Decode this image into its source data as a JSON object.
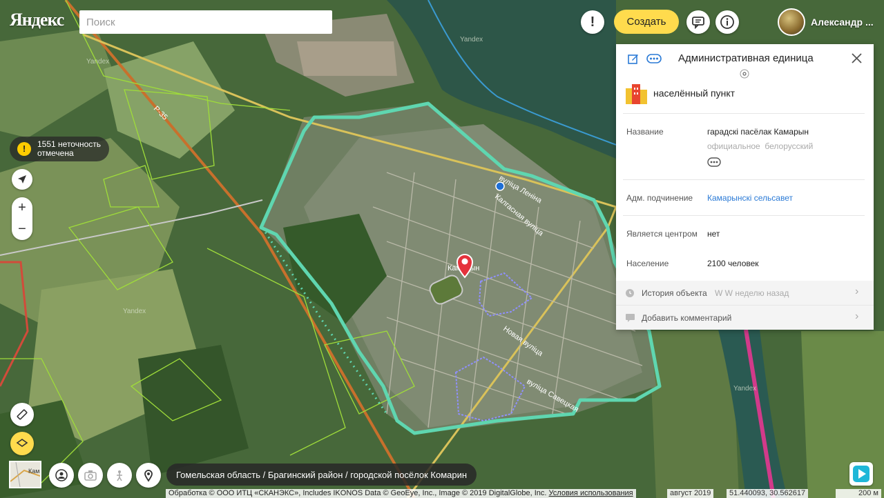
{
  "app": {
    "logo": "Яндекс"
  },
  "search": {
    "placeholder": "Поиск"
  },
  "header": {
    "create_label": "Создать",
    "user_name": "Александр ..."
  },
  "warning": {
    "count": "1551",
    "text_line1": "неточность",
    "text_line2": "отмечена"
  },
  "zoom": {
    "plus": "+",
    "minus": "−"
  },
  "breadcrumbs": "Гомельская область / Брагинский район / городской посёлок Комарин",
  "map_labels": {
    "town": "Камарын",
    "road": "Р-35",
    "street1": "вуліца Леніна",
    "street2": "Калгасная вуліца",
    "street3": "Новая вуліца",
    "street4": "вуліца Савецкая",
    "watermark": "Yandex",
    "minimap": "Кам"
  },
  "footer": {
    "copyright": "Обработка © ООО ИТЦ «СКАНЭКС», Includes IKONOS Data © GeoEye, Inc., Image © 2019 DigitalGlobe, Inc.",
    "terms": "Условия использования",
    "date": "август 2019",
    "coords": "51.440093, 30.562617",
    "scale": "200 м"
  },
  "panel": {
    "title": "Административная единица",
    "category": "населённый пункт",
    "name_label": "Название",
    "name_value": "гарадскі пасёлак Камарын",
    "name_meta1": "официальное",
    "name_meta2": "белорусский",
    "adm_label": "Адм. подчинение",
    "adm_value": "Камарынскі сельсавет",
    "center_label": "Является центром",
    "center_value": "нет",
    "pop_label": "Население",
    "pop_value": "2100 человек",
    "history_label": "История объекта",
    "history_meta": "W W неделю назад",
    "comment_label": "Добавить комментарий"
  },
  "colors": {
    "accent": "#ffdb4d",
    "boundary": "#5fd6b0",
    "link": "#2a7ad6",
    "river": "#2f5d4a"
  }
}
